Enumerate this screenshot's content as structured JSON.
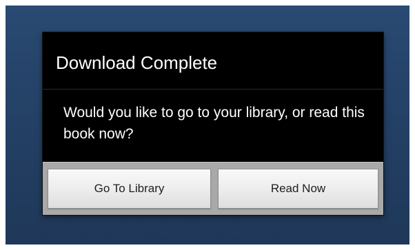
{
  "dialog": {
    "title": "Download Complete",
    "message": "Would you like to go to your library, or read this book now?",
    "buttons": {
      "library": "Go To Library",
      "read": "Read Now"
    }
  }
}
